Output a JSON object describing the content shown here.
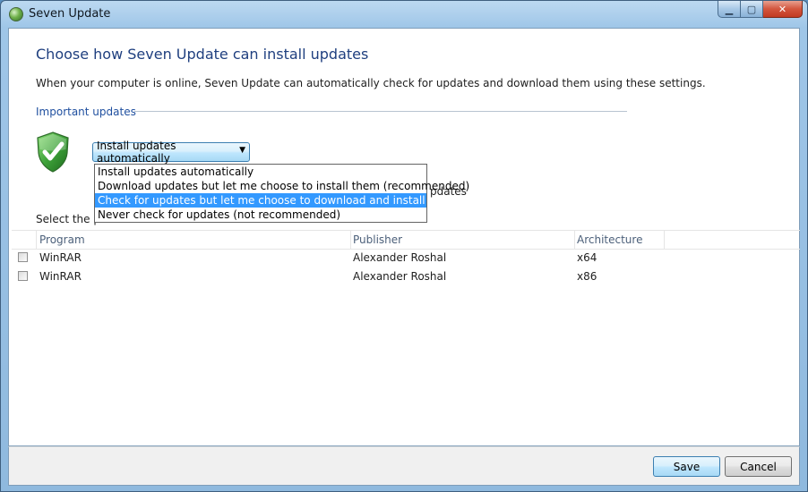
{
  "window": {
    "title": "Seven Update",
    "minimize_glyph": "▁",
    "maximize_glyph": "▢",
    "close_glyph": "✕"
  },
  "page": {
    "heading": "Choose how Seven Update can install updates",
    "description": "When your computer is online, Seven Update can automatically check for updates and download them using these settings.",
    "section_label": "Important updates",
    "select_programs_text": "Select the p",
    "partially_hidden_text": "pdates"
  },
  "combo": {
    "selected_value": "Install updates automatically",
    "arrow_glyph": "▼",
    "options": [
      "Install updates automatically",
      "Download updates but let me choose to install them (recommended)",
      "Check for updates but let me choose to download and install them",
      "Never check for updates (not recommended)"
    ],
    "highlighted_index": 2
  },
  "table": {
    "columns": [
      "Program",
      "Publisher",
      "Architecture"
    ],
    "rows": [
      {
        "program": "WinRAR",
        "publisher": "Alexander Roshal",
        "architecture": "x64",
        "checked": false
      },
      {
        "program": "WinRAR",
        "publisher": "Alexander Roshal",
        "architecture": "x86",
        "checked": false
      }
    ]
  },
  "footer": {
    "save_label": "Save",
    "cancel_label": "Cancel"
  },
  "colors": {
    "heading": "#1f3f7f",
    "section_label": "#1f4f9f",
    "highlight": "#3399ff",
    "shield_green": "#3fa33a"
  },
  "icons": {
    "app": "globe-icon",
    "shield": "security-shield-checkmark-icon"
  }
}
